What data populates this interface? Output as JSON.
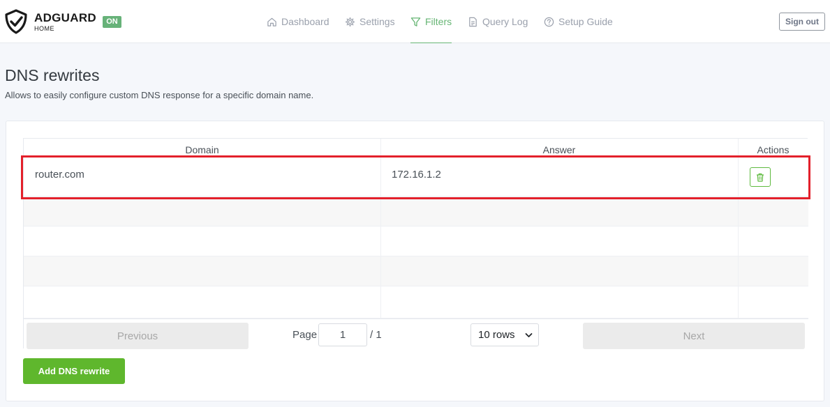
{
  "app": {
    "name": "ADGUARD",
    "subtitle": "HOME",
    "status": "ON"
  },
  "nav": {
    "items": [
      {
        "label": "Dashboard",
        "icon": "home-icon"
      },
      {
        "label": "Settings",
        "icon": "gear-icon"
      },
      {
        "label": "Filters",
        "icon": "filter-icon",
        "active": true
      },
      {
        "label": "Query Log",
        "icon": "document-icon"
      },
      {
        "label": "Setup Guide",
        "icon": "help-circle-icon"
      }
    ],
    "sign_out": "Sign out"
  },
  "page": {
    "title": "DNS rewrites",
    "description": "Allows to easily configure custom DNS response for a specific domain name."
  },
  "table": {
    "columns": [
      "Domain",
      "Answer",
      "Actions"
    ],
    "rows": [
      {
        "domain": "router.com",
        "answer": "172.16.1.2"
      }
    ]
  },
  "pagination": {
    "previous": "Previous",
    "page_label": "Page",
    "page_value": "1",
    "total": "/ 1",
    "rows_option": "10 rows",
    "next": "Next"
  },
  "actions": {
    "add_label": "Add DNS rewrite"
  },
  "colors": {
    "accent": "#66b574",
    "primary_button": "#5fb72d",
    "highlight": "#e3202b"
  }
}
